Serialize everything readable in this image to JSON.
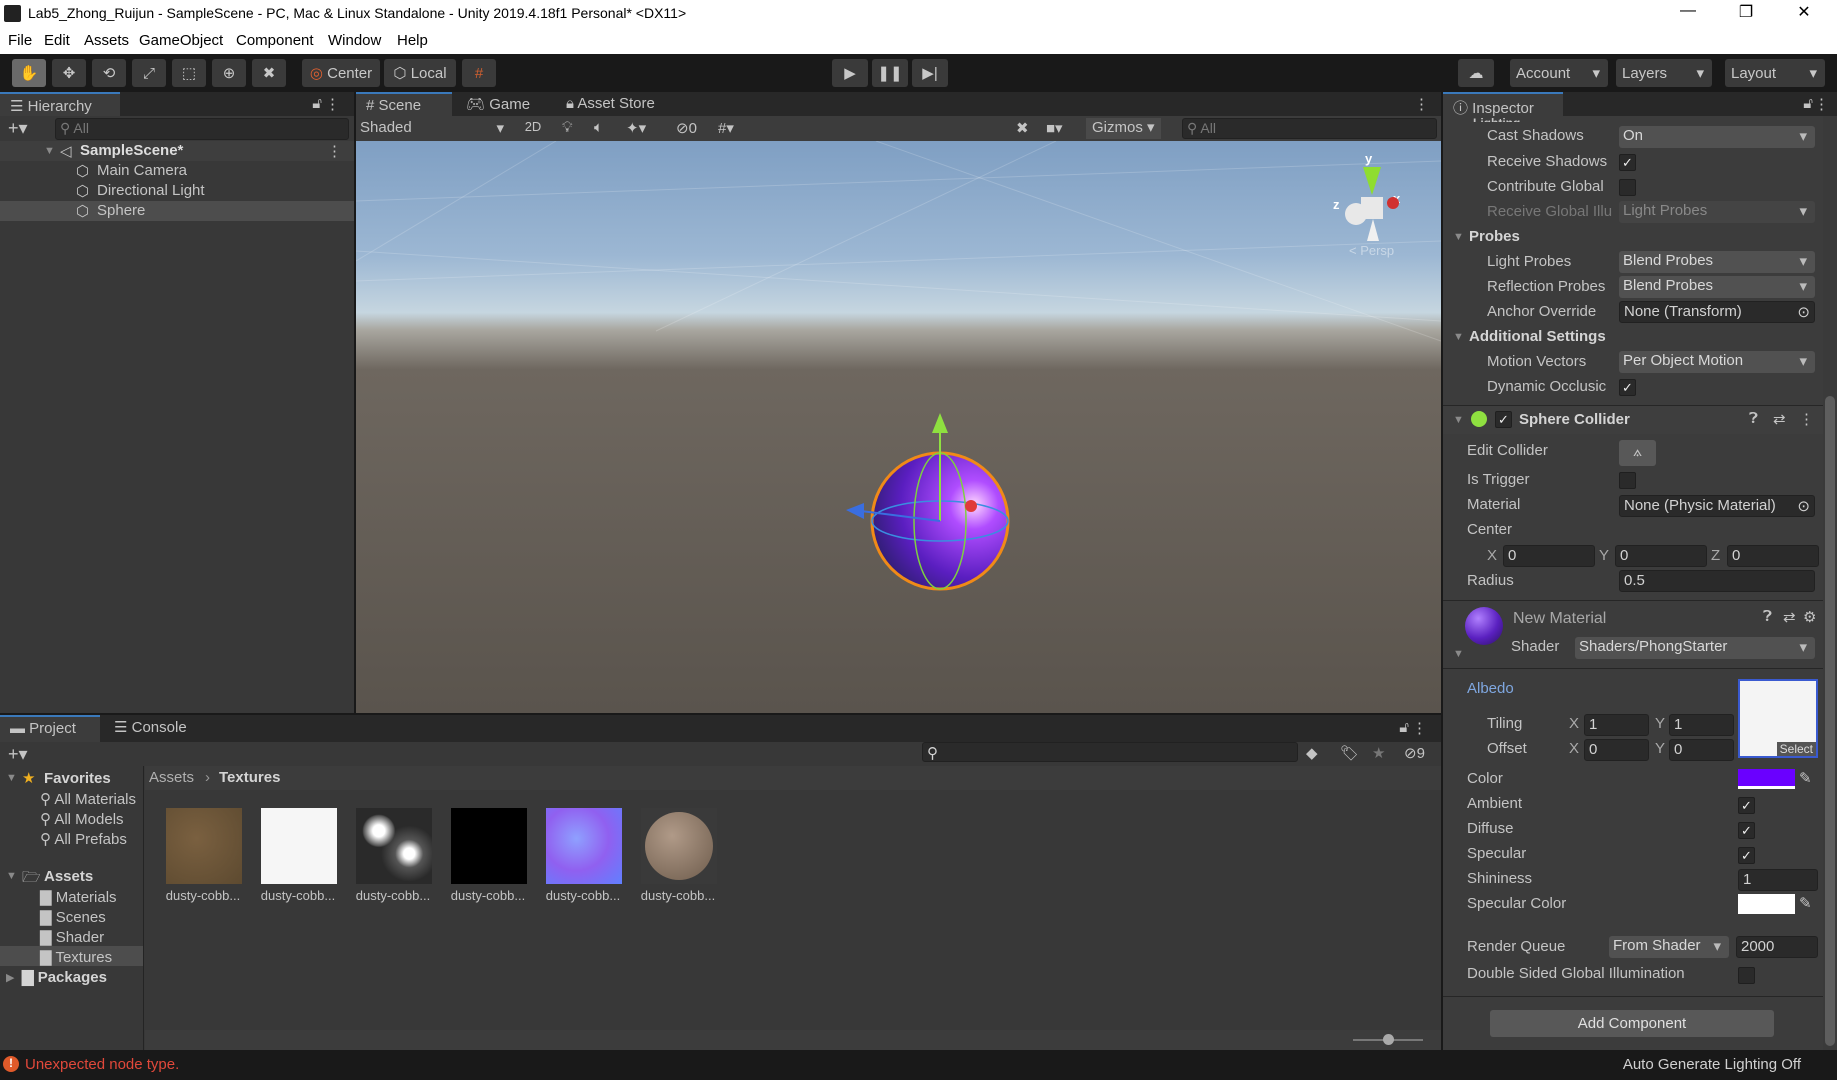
{
  "window": {
    "title": "Lab5_Zhong_Ruijun - SampleScene - PC, Mac & Linux Standalone - Unity 2019.4.18f1 Personal* <DX11>"
  },
  "menu": [
    "File",
    "Edit",
    "Assets",
    "GameObject",
    "Component",
    "Window",
    "Help"
  ],
  "toolbar": {
    "pivot": "Center",
    "space": "Local",
    "account": "Account",
    "layers": "Layers",
    "layout": "Layout"
  },
  "hierarchy": {
    "tab": "Hierarchy",
    "search_placeholder": "All",
    "scene": "SampleScene*",
    "items": [
      "Main Camera",
      "Directional Light",
      "Sphere"
    ]
  },
  "scene": {
    "tabs": [
      "Scene",
      "Game",
      "Asset Store"
    ],
    "shading": "Shaded",
    "mode_2d": "2D",
    "hidden_count": "0",
    "gizmos": "Gizmos",
    "search_placeholder": "All",
    "persp": "< Persp",
    "axis": {
      "x": "x",
      "y": "y",
      "z": "z"
    }
  },
  "project": {
    "tabs": [
      "Project",
      "Console"
    ],
    "hidden_count": "9",
    "favorites": "Favorites",
    "fav_items": [
      "All Materials",
      "All Models",
      "All Prefabs"
    ],
    "assets": "Assets",
    "asset_folders": [
      "Materials",
      "Scenes",
      "Shader",
      "Textures"
    ],
    "packages": "Packages",
    "breadcrumb": [
      "Assets",
      "Textures"
    ],
    "files": [
      "dusty-cobb...",
      "dusty-cobb...",
      "dusty-cobb...",
      "dusty-cobb...",
      "dusty-cobb...",
      "dusty-cobb..."
    ]
  },
  "inspector": {
    "tab": "Inspector",
    "section_cut": "Lighting",
    "cast_shadows": {
      "label": "Cast Shadows",
      "value": "On"
    },
    "receive_shadows": {
      "label": "Receive Shadows",
      "checked": true
    },
    "contribute_gi": {
      "label": "Contribute Global",
      "checked": false
    },
    "receive_gi": {
      "label": "Receive Global Illu",
      "value": "Light Probes"
    },
    "probes": "Probes",
    "light_probes": {
      "label": "Light Probes",
      "value": "Blend Probes"
    },
    "reflection_probes": {
      "label": "Reflection Probes",
      "value": "Blend Probes"
    },
    "anchor_override": {
      "label": "Anchor Override",
      "value": "None (Transform)"
    },
    "additional": "Additional Settings",
    "motion_vectors": {
      "label": "Motion Vectors",
      "value": "Per Object Motion"
    },
    "dynamic_occlusion": {
      "label": "Dynamic Occlusic",
      "checked": true
    },
    "collider": {
      "title": "Sphere Collider",
      "edit": "Edit Collider",
      "is_trigger": "Is Trigger",
      "material_label": "Material",
      "material": "None (Physic Material)",
      "center": "Center",
      "cx": "0",
      "cy": "0",
      "cz": "0",
      "radius_label": "Radius",
      "radius": "0.5"
    },
    "material": {
      "name": "New Material",
      "shader_label": "Shader",
      "shader": "Shaders/PhongStarter",
      "albedo": "Albedo",
      "tiling": "Tiling",
      "offset": "Offset",
      "tx": "1",
      "ty": "1",
      "ox": "0",
      "oy": "0",
      "select": "Select",
      "color_label": "Color",
      "color": "#6a00ff",
      "ambient": "Ambient",
      "diffuse": "Diffuse",
      "specular": "Specular",
      "shininess_label": "Shininess",
      "shininess": "1",
      "spec_color_label": "Specular Color",
      "spec_color": "#ffffff",
      "render_queue": "Render Queue",
      "rq_mode": "From Shader",
      "rq_value": "2000",
      "double_sided": "Double Sided Global Illumination"
    },
    "add_component": "Add Component"
  },
  "status": {
    "error": "Unexpected node type.",
    "lighting": "Auto Generate Lighting Off"
  },
  "axis_labels": {
    "x": "X",
    "y": "Y",
    "z": "Z"
  }
}
